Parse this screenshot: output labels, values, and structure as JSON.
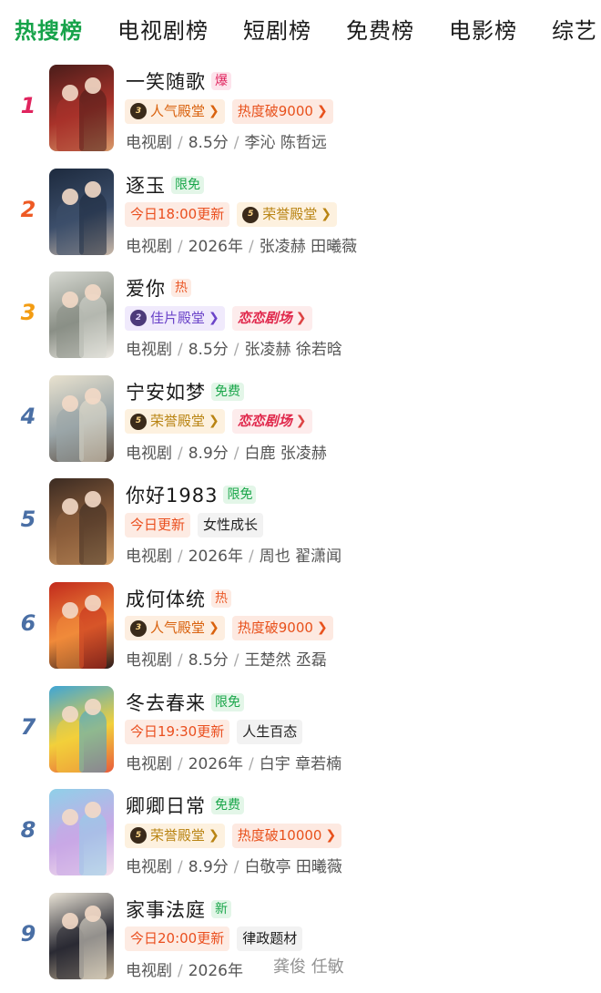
{
  "tabs": [
    "热搜榜",
    "电视剧榜",
    "短剧榜",
    "免费榜",
    "电影榜",
    "综艺"
  ],
  "colors": {
    "accent": "#17a34a",
    "r1": "#e0245e",
    "r2": "#ee5a24",
    "r3": "#f39c12",
    "r_rest": "#4a6fa5"
  },
  "items": [
    {
      "rank": "1",
      "title": "一笑随歌",
      "badge": "爆",
      "badge_type": "hot",
      "tags": [
        {
          "type": "popular",
          "medal": "3",
          "text": "人气殿堂",
          "chevron": true
        },
        {
          "type": "heat",
          "text": "热度破9000",
          "chevron": true
        }
      ],
      "category": "电视剧",
      "info": "8.5分",
      "cast": "李沁 陈哲远",
      "poster_colors": [
        "#4a1d1a",
        "#a8322a",
        "#d89a6a"
      ]
    },
    {
      "rank": "2",
      "title": "逐玉",
      "badge": "限免",
      "badge_type": "free",
      "tags": [
        {
          "type": "update",
          "text": "今日18:00更新",
          "chevron": false
        },
        {
          "type": "honor",
          "medal": "5",
          "text": "荣誉殿堂",
          "chevron": true
        }
      ],
      "category": "电视剧",
      "info": "2026年",
      "cast": "张凌赫 田曦薇",
      "poster_colors": [
        "#1d2a3e",
        "#3c4e6a",
        "#c9b8a8"
      ]
    },
    {
      "rank": "3",
      "title": "爱你",
      "badge": "热",
      "badge_type": "warm",
      "tags": [
        {
          "type": "fine",
          "medal": "2",
          "text": "佳片殿堂",
          "chevron": true
        },
        {
          "type": "theater",
          "text": "恋恋剧场",
          "chevron": true
        }
      ],
      "category": "电视剧",
      "info": "8.5分",
      "cast": "张凌赫 徐若晗",
      "poster_colors": [
        "#d7d9d2",
        "#8a8f86",
        "#f0ede6"
      ]
    },
    {
      "rank": "4",
      "title": "宁安如梦",
      "badge": "免费",
      "badge_type": "free",
      "tags": [
        {
          "type": "honor",
          "medal": "5",
          "text": "荣誉殿堂",
          "chevron": true
        },
        {
          "type": "theater",
          "text": "恋恋剧场",
          "chevron": true
        }
      ],
      "category": "电视剧",
      "info": "8.9分",
      "cast": "白鹿 张凌赫",
      "poster_colors": [
        "#e9e2cf",
        "#9aa5a8",
        "#5b4a3c"
      ]
    },
    {
      "rank": "5",
      "title": "你好1983",
      "badge": "限免",
      "badge_type": "free",
      "tags": [
        {
          "type": "update",
          "text": "今日更新",
          "chevron": false
        },
        {
          "type": "genre",
          "text": "女性成长",
          "chevron": false
        }
      ],
      "category": "电视剧",
      "info": "2026年",
      "cast": "周也 翟潇闻",
      "poster_colors": [
        "#3b2b22",
        "#8b5d3b",
        "#d7a46b"
      ]
    },
    {
      "rank": "6",
      "title": "成何体统",
      "badge": "热",
      "badge_type": "warm",
      "tags": [
        {
          "type": "popular",
          "medal": "3",
          "text": "人气殿堂",
          "chevron": true
        },
        {
          "type": "heat",
          "text": "热度破9000",
          "chevron": true
        }
      ],
      "category": "电视剧",
      "info": "8.5分",
      "cast": "王楚然 丞磊",
      "poster_colors": [
        "#c22a1c",
        "#f08a3a",
        "#2c1a1a"
      ]
    },
    {
      "rank": "7",
      "title": "冬去春来",
      "badge": "限免",
      "badge_type": "free",
      "tags": [
        {
          "type": "update",
          "text": "今日19:30更新",
          "chevron": false
        },
        {
          "type": "genre",
          "text": "人生百态",
          "chevron": false
        }
      ],
      "category": "电视剧",
      "info": "2026年",
      "cast": "白宇 章若楠",
      "poster_colors": [
        "#3ea5d6",
        "#f2d03b",
        "#e85b3b"
      ]
    },
    {
      "rank": "8",
      "title": "卿卿日常",
      "badge": "免费",
      "badge_type": "free",
      "tags": [
        {
          "type": "honor",
          "medal": "5",
          "text": "荣誉殿堂",
          "chevron": true
        },
        {
          "type": "heat",
          "text": "热度破10000",
          "chevron": true
        }
      ],
      "category": "电视剧",
      "info": "8.9分",
      "cast": "白敬亭 田曦薇",
      "poster_colors": [
        "#8fd0e8",
        "#c9a8e6",
        "#f6e2ec"
      ]
    },
    {
      "rank": "9",
      "title": "家事法庭",
      "badge": "新",
      "badge_type": "free",
      "tags": [
        {
          "type": "update",
          "text": "今日20:00更新",
          "chevron": false
        },
        {
          "type": "genre",
          "text": "律政题材",
          "chevron": false
        }
      ],
      "category": "电视剧",
      "info": "2026年",
      "cast": "",
      "poster_colors": [
        "#e9e3d6",
        "#2a2a33",
        "#b8a88e"
      ]
    }
  ],
  "watermark": "龚俊 任敏"
}
